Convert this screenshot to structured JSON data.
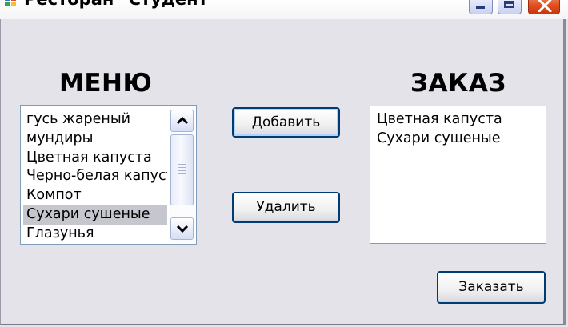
{
  "window": {
    "title": "Ресторан \"Студент\"",
    "icons": {
      "app": "app-icon",
      "minimize": "minimize-icon",
      "maximize": "maximize-icon",
      "close": "close-icon"
    }
  },
  "menu": {
    "heading": "МЕНЮ",
    "items": [
      {
        "label": "гусь жареный"
      },
      {
        "label": "мундиры"
      },
      {
        "label": "Цветная капуста"
      },
      {
        "label": "Черно-белая капуста"
      },
      {
        "label": "Компот"
      },
      {
        "label": "Сухари сушеные",
        "selected": true
      },
      {
        "label": "Глазунья"
      }
    ],
    "selected_item": "Сухари сушеные"
  },
  "order": {
    "heading": "ЗАКАЗ",
    "items": [
      {
        "label": "Цветная капуста"
      },
      {
        "label": "Сухари сушеные"
      }
    ]
  },
  "buttons": {
    "add": "Добавить",
    "remove": "Удалить",
    "order": "Заказать"
  }
}
